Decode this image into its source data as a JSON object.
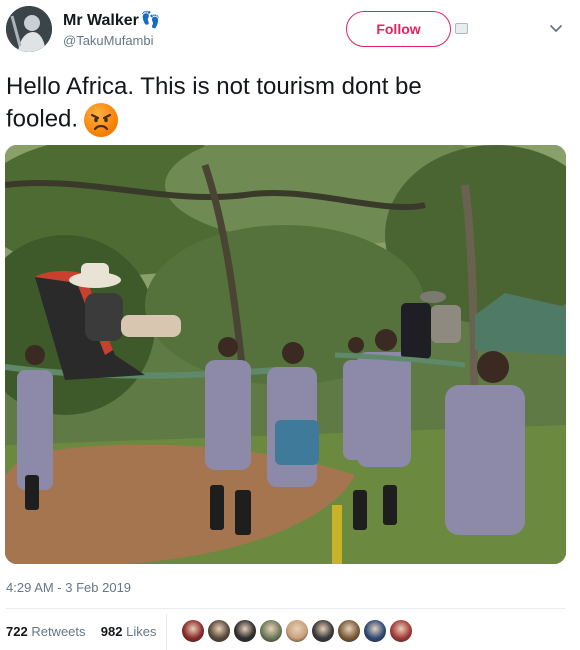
{
  "user": {
    "name": "Mr Walker",
    "name_emoji": "👣",
    "handle": "@TakuMufambi"
  },
  "actions": {
    "follow_label": "Follow"
  },
  "tweet": {
    "text_line1": "Hello Africa.  This is not tourism dont be",
    "text_line2": "fooled.",
    "emoji": "angry-face"
  },
  "meta": {
    "timestamp": "4:29 AM - 3 Feb 2019",
    "retweets_count": "722",
    "retweets_label": "Retweets",
    "likes_count": "982",
    "likes_label": "Likes"
  },
  "likers": [
    {
      "color": "#8b2b2b"
    },
    {
      "color": "#5c4a3b"
    },
    {
      "color": "#2f2f2f"
    },
    {
      "color": "#6c7a5a"
    },
    {
      "color": "#c9a27a"
    },
    {
      "color": "#3a3a3a"
    },
    {
      "color": "#7a5c3a"
    },
    {
      "color": "#2e4a7a"
    },
    {
      "color": "#a33a3a"
    }
  ],
  "colors": {
    "accent": "#e0245e",
    "secondary_text": "#657786"
  }
}
